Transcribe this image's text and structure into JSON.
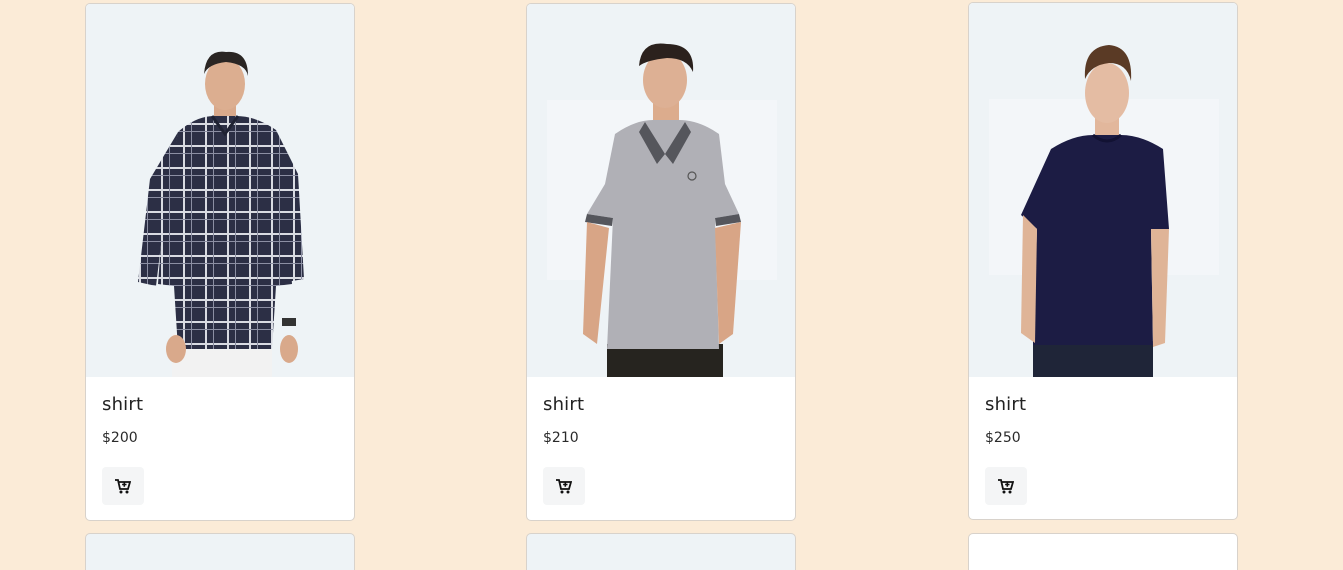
{
  "products": [
    {
      "name": "shirt",
      "price": "$200",
      "image_icon": "plaid-shirt-model-image",
      "cart_icon": "cart-plus-icon"
    },
    {
      "name": "shirt",
      "price": "$210",
      "image_icon": "grey-polo-model-image",
      "cart_icon": "cart-plus-icon"
    },
    {
      "name": "shirt",
      "price": "$250",
      "image_icon": "navy-tshirt-model-image",
      "cart_icon": "cart-plus-icon"
    }
  ],
  "colors": {
    "page_background": "#fbebd7",
    "image_background": "#eef3f6",
    "card_background": "#ffffff"
  }
}
